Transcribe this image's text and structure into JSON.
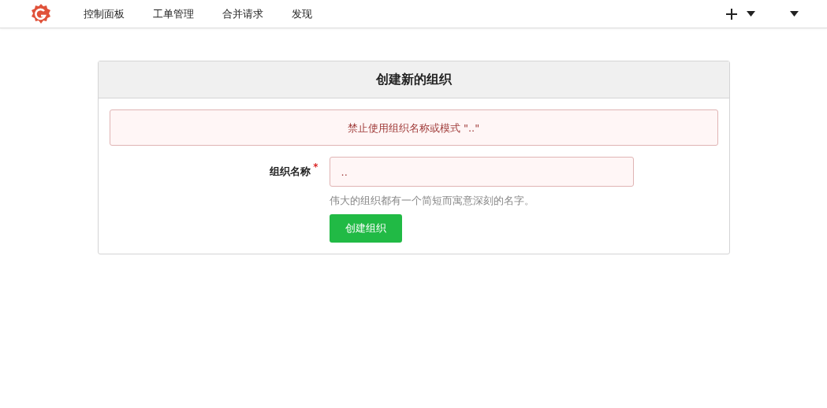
{
  "navbar": {
    "items": [
      {
        "label": "控制面板"
      },
      {
        "label": "工单管理"
      },
      {
        "label": "合并请求"
      },
      {
        "label": "发现"
      }
    ]
  },
  "form": {
    "title": "创建新的组织",
    "error_message": "禁止使用组织名称或模式 \"..\"",
    "field": {
      "label": "组织名称",
      "required_mark": "*",
      "value": "..",
      "error": true,
      "help": "伟大的组织都有一个简短而寓意深刻的名字。"
    },
    "submit": "创建组织"
  }
}
